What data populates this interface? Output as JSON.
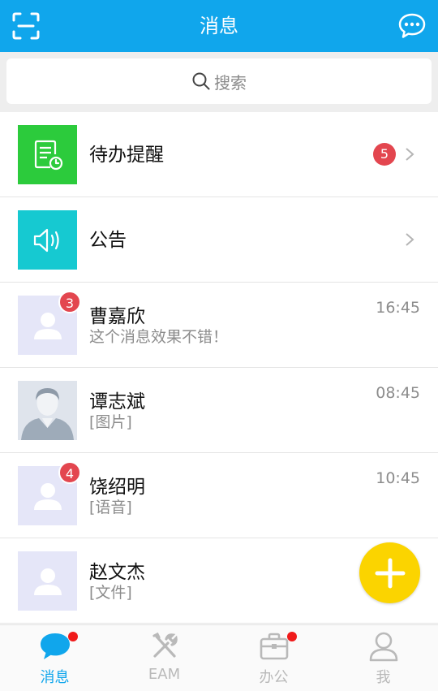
{
  "header": {
    "title": "消息",
    "left_icon": "scan-icon",
    "right_icon": "chat-bubble-icon",
    "color": "#10a6ec"
  },
  "search": {
    "placeholder": "搜索",
    "icon": "search-icon"
  },
  "list": [
    {
      "type": "system",
      "name": "待办提醒",
      "icon": "todo-reminder-icon",
      "color": "#2ccb3c",
      "count": "5"
    },
    {
      "type": "system",
      "name": "公告",
      "icon": "speaker-icon",
      "color": "#16c9d1"
    },
    {
      "type": "contact",
      "name": "曹嘉欣",
      "preview": "这个消息效果不错！",
      "time": "16:45",
      "unread": "3",
      "avatar": "default-avatar"
    },
    {
      "type": "contact",
      "name": "谭志斌",
      "preview": "[图片]",
      "time": "08:45",
      "avatar": "photo-avatar"
    },
    {
      "type": "contact",
      "name": "饶绍明",
      "preview": "[语音]",
      "time": "10:45",
      "unread": "4",
      "avatar": "default-avatar"
    },
    {
      "type": "contact",
      "name": "赵文杰",
      "preview": "[文件]",
      "time": "",
      "avatar": "default-avatar"
    }
  ],
  "fab": {
    "icon": "plus-icon",
    "color": "#fbd400"
  },
  "tabs": [
    {
      "label": "消息",
      "icon": "message-icon",
      "active": true,
      "dot": true
    },
    {
      "label": "EAM",
      "icon": "tools-icon",
      "active": false,
      "dot": false
    },
    {
      "label": "办公",
      "icon": "briefcase-icon",
      "active": false,
      "dot": true
    },
    {
      "label": "我",
      "icon": "person-icon",
      "active": false,
      "dot": false
    }
  ]
}
